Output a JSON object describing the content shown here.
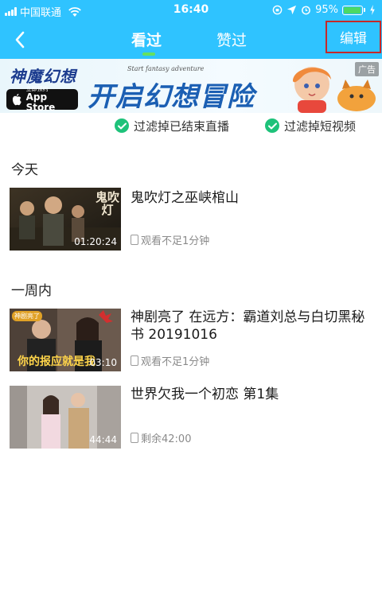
{
  "status_bar": {
    "carrier": "中国联通",
    "time": "16:40",
    "battery": "95%"
  },
  "nav": {
    "tabs": [
      {
        "label": "看过",
        "active": true
      },
      {
        "label": "赞过",
        "active": false
      }
    ],
    "edit_label": "编辑"
  },
  "ad": {
    "game_name": "神魔幻想",
    "appstore_small": "立即预约",
    "appstore_label": "App Store",
    "tagline": "Start fantasy adventure",
    "headline": "开启幻想冒险",
    "label": "广告"
  },
  "filters": [
    {
      "label": "过滤掉已结束直播",
      "checked": true
    },
    {
      "label": "过滤掉短视频",
      "checked": true
    }
  ],
  "sections": [
    {
      "title": "今天",
      "items": [
        {
          "title": "鬼吹灯之巫峡棺山",
          "duration": "01:20:24",
          "progress": "观看不足1分钟",
          "thumb_text": "鬼吹灯"
        }
      ]
    },
    {
      "title": "一周内",
      "items": [
        {
          "title": "神剧亮了 在远方：霸道刘总与白切黑秘书 20191016",
          "duration": "03:10",
          "progress": "观看不足1分钟",
          "thumb_text": "你的报应就是我",
          "thumb_badge": "神剧亮了"
        },
        {
          "title": "世界欠我一个初恋 第1集",
          "duration": "44:44",
          "progress": "剩余42:00"
        }
      ]
    }
  ],
  "colors": {
    "header_bg": "#2fc3ff",
    "tab_indicator": "#66e05e",
    "check_green": "#1ec27a",
    "edit_highlight": "#c62828"
  }
}
